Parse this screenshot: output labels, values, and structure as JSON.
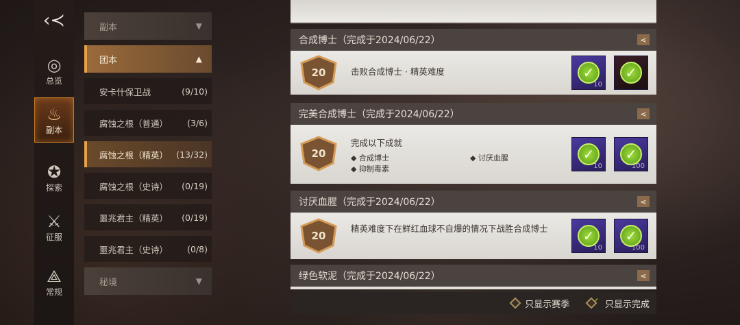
{
  "nav": {
    "items": [
      {
        "label": "总览",
        "icon": "eye-icon",
        "glyph": "◎"
      },
      {
        "label": "副本",
        "icon": "dungeon-icon",
        "glyph": "♨"
      },
      {
        "label": "探索",
        "icon": "compass-icon",
        "glyph": "✪"
      },
      {
        "label": "征服",
        "icon": "crossed-swords-icon",
        "glyph": "⚔"
      },
      {
        "label": "常规",
        "icon": "triangle-emblem-icon",
        "glyph": "⟁"
      }
    ],
    "active_index": 1
  },
  "categories": {
    "dungeon_label": "副本",
    "raid_label": "团本",
    "secret_label": "秘境",
    "raid_items": [
      {
        "name": "安卡什保卫战",
        "count": "(9/10)"
      },
      {
        "name": "腐蚀之根（普通）",
        "count": "(3/6)"
      },
      {
        "name": "腐蚀之根（精英）",
        "count": "(13/32)"
      },
      {
        "name": "腐蚀之根（史诗）",
        "count": "(0/19)"
      },
      {
        "name": "噩兆君主（精英）",
        "count": "(0/19)"
      },
      {
        "name": "噩兆君主（史诗）",
        "count": "(0/8)"
      }
    ],
    "active_item_index": 2
  },
  "achievements": [
    {
      "title": "合成博士（完成于2024/06/22）",
      "points": "20",
      "desc": "击败合成博士 · 精英难度",
      "rewards": [
        {
          "qty": "10"
        },
        {
          "qty": ""
        }
      ]
    },
    {
      "title": "完美合成博士（完成于2024/06/22）",
      "points": "20",
      "desc": "完成以下成就",
      "criteria": [
        "◆ 合成博士",
        "◆ 讨厌血腥",
        "◆ 抑制毒素"
      ],
      "rewards": [
        {
          "qty": "10"
        },
        {
          "qty": "100"
        }
      ]
    },
    {
      "title": "讨厌血腥（完成于2024/06/22）",
      "points": "20",
      "desc": "精英难度下在鲜红血球不自爆的情况下战胜合成博士",
      "rewards": [
        {
          "qty": "10"
        },
        {
          "qty": "100"
        }
      ]
    },
    {
      "title": "绿色软泥（完成于2024/06/22）"
    }
  ],
  "footer": {
    "season_only_label": "只显示赛季",
    "completed_only_label": "只显示完成"
  },
  "colors": {
    "accent": "#e6a24a",
    "reward_bg": "#3a2a80",
    "check_green": "#8ad02a"
  }
}
